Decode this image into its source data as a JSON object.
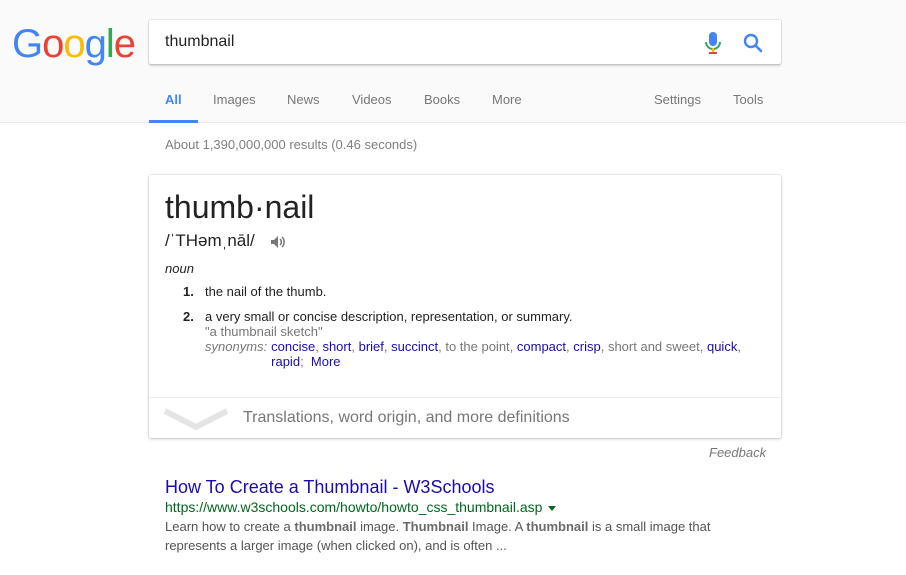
{
  "logo": {
    "letters": [
      "G",
      "o",
      "o",
      "g",
      "l",
      "e"
    ]
  },
  "search": {
    "query": "thumbnail"
  },
  "tabs": {
    "all": "All",
    "images": "Images",
    "news": "News",
    "videos": "Videos",
    "books": "Books",
    "more": "More",
    "settings": "Settings",
    "tools": "Tools"
  },
  "stats": "About 1,390,000,000 results (0.46 seconds)",
  "dictionary": {
    "word": "thumb·nail",
    "phonetic": "/ˈTHəmˌnāl/",
    "part_of_speech": "noun",
    "definitions": [
      {
        "num": "1.",
        "text": "the nail of the thumb."
      },
      {
        "num": "2.",
        "text": "a very small or concise description, representation, or summary.",
        "example": "\"a thumbnail sketch\""
      }
    ],
    "synonyms_label": "synonyms:",
    "synonyms": [
      "concise",
      "short",
      "brief",
      "succinct",
      "to the point",
      "compact",
      "crisp",
      "short and sweet",
      "quick",
      "rapid"
    ],
    "synonyms_more": "More",
    "more_definitions": "Translations, word origin, and more definitions"
  },
  "feedback": "Feedback",
  "result": {
    "title": "How To Create a Thumbnail - W3Schools",
    "url": "https://www.w3schools.com/howto/howto_css_thumbnail.asp",
    "snippet": {
      "s1": "Learn how to create a ",
      "b1": "thumbnail",
      "s2": " image. ",
      "b2": "Thumbnail",
      "s3": " Image. A ",
      "b3": "thumbnail",
      "s4": " is a small image that represents a larger image (when clicked on), and is often ..."
    }
  },
  "colors": {
    "accent": "#4285f4",
    "link": "#1a0dab",
    "url": "#006621"
  }
}
